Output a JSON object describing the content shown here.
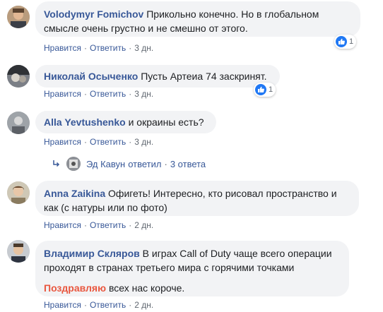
{
  "comments": [
    {
      "author": "Volodymyr Fomichov",
      "text_line1": "Прикольно конечно. Но в глобальном",
      "text_line2": "смысле очень грустно и не смешно от этого.",
      "like": "Нравится",
      "reply": "Ответить",
      "time": "3 дн.",
      "reactions": "1"
    },
    {
      "author": "Николай Осыченко",
      "text": "Пусть Артеиа 74 заскринят.",
      "like": "Нравится",
      "reply": "Ответить",
      "time": "3 дн.",
      "reactions": "1"
    },
    {
      "author": "Alla Yevtushenko",
      "text": "и окраины есть?",
      "like": "Нравится",
      "reply": "Ответить",
      "time": "3 дн."
    },
    {
      "author": "Anna Zaikina",
      "text_line1": "Офигеть! Интересно, кто рисовал пространство и",
      "text_line2": "как (с натуры или по фото)",
      "like": "Нравится",
      "reply": "Ответить",
      "time": "2 дн."
    },
    {
      "author": "Владимир Скляров",
      "text_line1": "В играх Call of Duty чаще всего операции",
      "text_line2": "проходят в странах третьего мира с горячими точками",
      "link": "Поздравляю",
      "text_line3": "всех нас короче.",
      "like": "Нравится",
      "reply": "Ответить",
      "time": "2 дн."
    }
  ],
  "replies_summary": {
    "name": "Эд Кавун",
    "verb": "ответил",
    "count": "3 ответа"
  },
  "separator": "·",
  "colors": {
    "link": "#385898",
    "bubble": "#f2f3f5",
    "meta": "#606770",
    "like_badge": "#2078f4",
    "highlight": "#e9573f"
  },
  "icons": [
    "reply-arrow-icon",
    "like-reaction-icon"
  ]
}
